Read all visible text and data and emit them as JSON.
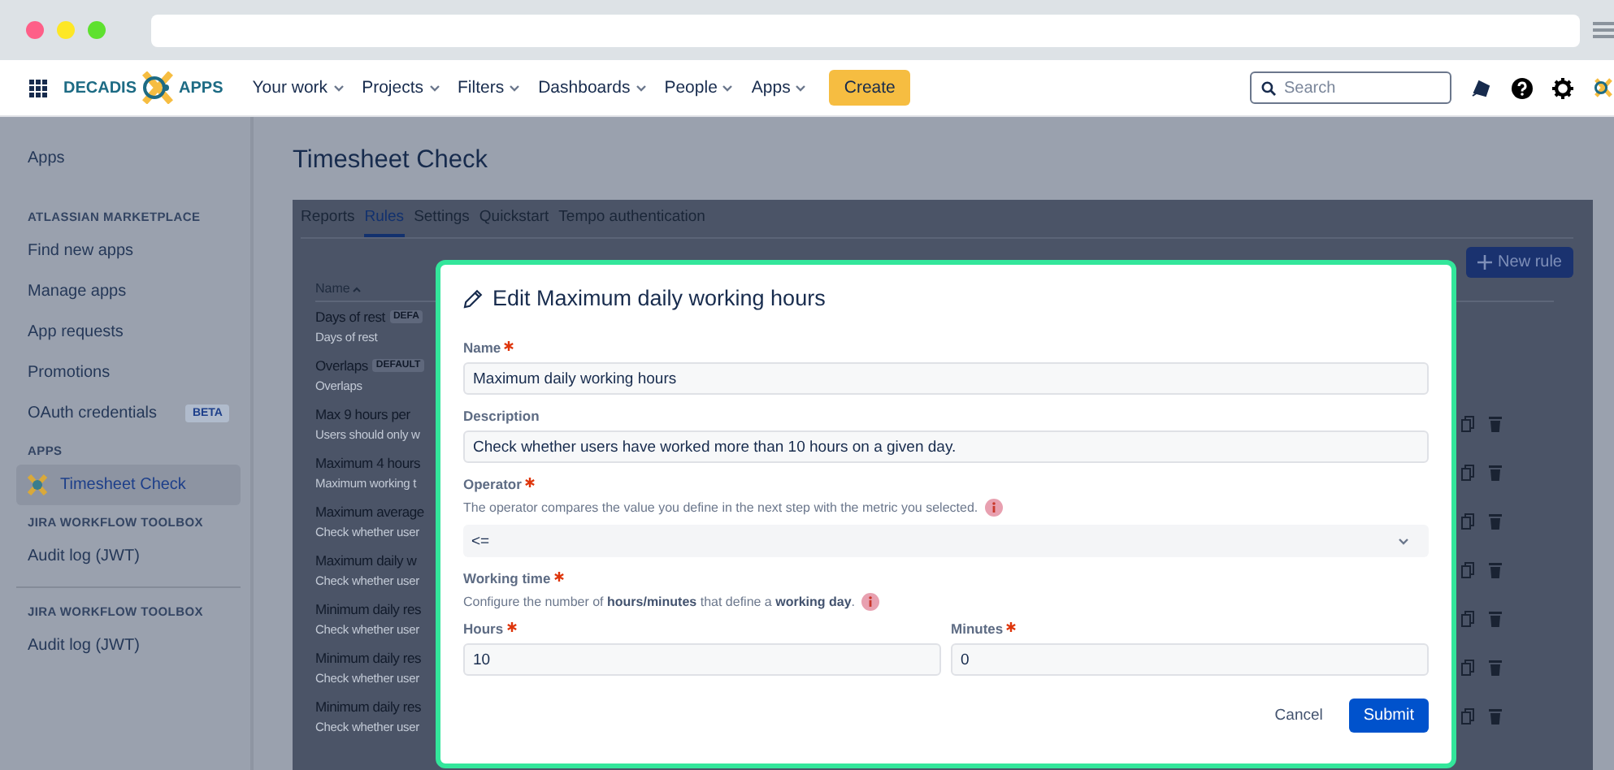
{
  "nav": {
    "logo": "DECADIS",
    "logo_suffix": "APPS",
    "items": [
      {
        "label": "Your work"
      },
      {
        "label": "Projects"
      },
      {
        "label": "Filters"
      },
      {
        "label": "Dashboards"
      },
      {
        "label": "People"
      },
      {
        "label": "Apps"
      }
    ],
    "create": "Create",
    "search": {
      "placeholder": "Search"
    }
  },
  "sidebar": {
    "title": "Apps",
    "sections": [
      {
        "heading": "ATLASSIAN MARKETPLACE",
        "separated": false,
        "items": [
          {
            "label": "Find new apps",
            "selected": false
          },
          {
            "label": "Manage apps",
            "selected": false
          },
          {
            "label": "App requests",
            "selected": false
          },
          {
            "label": "Promotions",
            "selected": false
          },
          {
            "label": "OAuth credentials",
            "selected": false,
            "badge": "BETA"
          }
        ]
      },
      {
        "heading": "APPS",
        "separated": false,
        "items": [
          {
            "label": "Timesheet Check",
            "selected": true,
            "kind": "app"
          }
        ]
      },
      {
        "heading": "JIRA WORKFLOW TOOLBOX",
        "separated": false,
        "items": [
          {
            "label": "Audit log (JWT)",
            "selected": false
          }
        ]
      },
      {
        "heading": "JIRA WORKFLOW TOOLBOX",
        "separated": true,
        "items": [
          {
            "label": "Audit log (JWT)",
            "selected": false
          }
        ]
      }
    ]
  },
  "page": {
    "title": "Timesheet Check",
    "tabs": [
      {
        "label": "Reports",
        "selected": false
      },
      {
        "label": "Rules",
        "selected": true
      },
      {
        "label": "Settings",
        "selected": false
      },
      {
        "label": "Quickstart",
        "selected": false
      },
      {
        "label": "Tempo authentication",
        "selected": false
      }
    ],
    "new_rule": "New rule",
    "table": {
      "columns": [
        {
          "label": "Name",
          "sorted": true
        }
      ],
      "rows": [
        {
          "name": "Days of rest",
          "badge": "DEFA",
          "description": "Days of rest",
          "actions": false
        },
        {
          "name": "Overlaps",
          "badge": "DEFAULT",
          "description": "Overlaps",
          "actions": false
        },
        {
          "name": "Max 9 hours per",
          "description": "Users should only w",
          "actions": true
        },
        {
          "name": "Maximum 4 hours",
          "description": "Maximum working t",
          "actions": true
        },
        {
          "name": "Maximum average",
          "description": "Check whether user",
          "actions": true
        },
        {
          "name": "Maximum daily w",
          "description": "Check whether user",
          "actions": true
        },
        {
          "name": "Minimum daily res",
          "description": "Check whether user",
          "actions": true
        },
        {
          "name": "Minimum daily res",
          "description": "Check whether user",
          "actions": true
        },
        {
          "name": "Minimum daily res",
          "description": "Check whether user",
          "actions": true
        }
      ]
    }
  },
  "modal": {
    "title": "Edit Maximum daily working hours",
    "name": {
      "label": "Name",
      "required": true,
      "value": "Maximum daily working hours"
    },
    "description": {
      "label": "Description",
      "required": false,
      "value": "Check whether users have worked more than 10 hours on a given day."
    },
    "operator": {
      "label": "Operator",
      "required": true,
      "help": "The operator compares the value you define in the next step with the metric you selected.",
      "value": "<="
    },
    "working_time": {
      "label": "Working time",
      "required": true,
      "help": "Configure the number of **hours/minutes** that define a **working day**."
    },
    "hours": {
      "label": "Hours",
      "required": true,
      "value": "10"
    },
    "minutes": {
      "label": "Minutes",
      "required": true,
      "value": "0"
    },
    "cancel": "Cancel",
    "submit": "Submit"
  }
}
